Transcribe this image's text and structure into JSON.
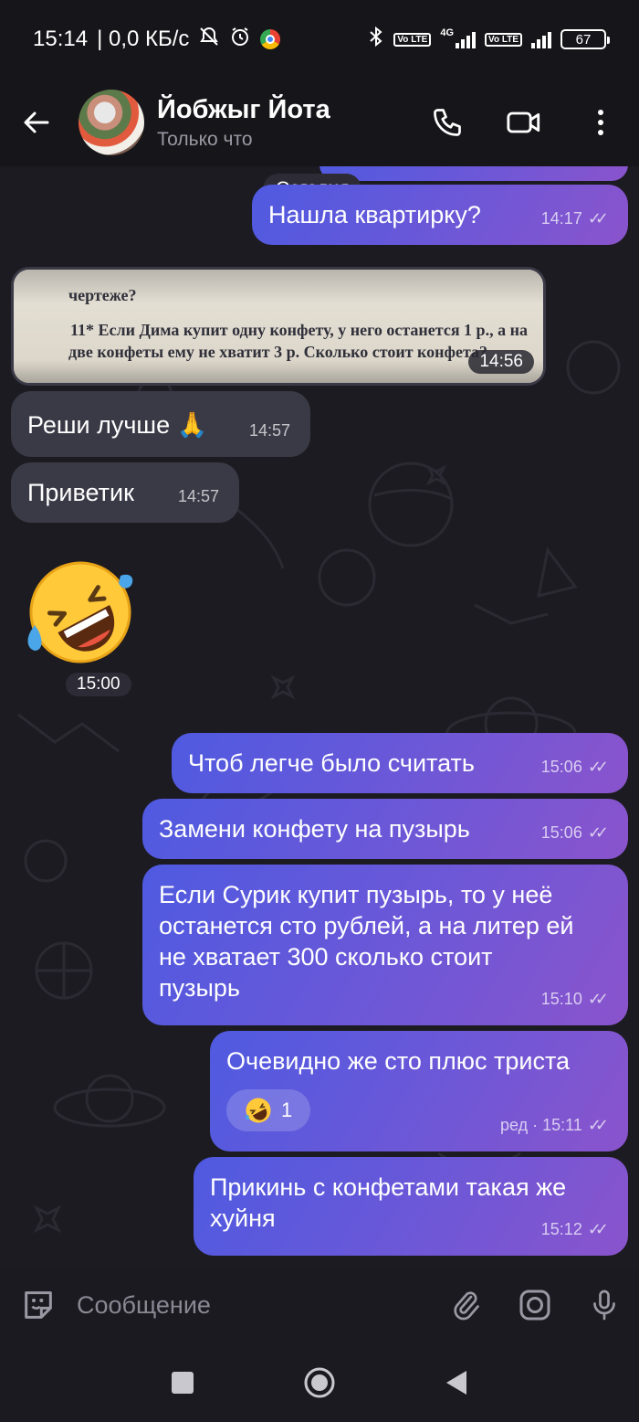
{
  "status_bar": {
    "time": "15:14",
    "speed": "| 0,0 КБ/с",
    "network": "4G",
    "lte_label": "Vo LTE",
    "battery": "67"
  },
  "header": {
    "name": "Йобжыг Йота",
    "status": "Только что"
  },
  "chat": {
    "date_divider": "Сегодня",
    "messages": [
      {
        "direction": "out",
        "text": "Нашла квартирку?",
        "time": "14:17"
      },
      {
        "direction": "in",
        "type": "photo",
        "photo_lines": [
          "чертеже?",
          "11* Если Дима купит одну конфету, у него останется 1 р., а на",
          "две конфеты ему не хватит 3 р. Сколько стоит конфета?"
        ],
        "time": "14:56"
      },
      {
        "direction": "in",
        "text": "Реши лучше 🙏",
        "time": "14:57"
      },
      {
        "direction": "in",
        "text": "Приветик",
        "time": "14:57"
      },
      {
        "direction": "in",
        "type": "emoji",
        "emoji": "rolling-on-floor-laughing",
        "time": "15:00"
      },
      {
        "direction": "out",
        "text": "Чтоб легче было считать",
        "time": "15:06"
      },
      {
        "direction": "out",
        "text": "Замени конфету на пузырь",
        "time": "15:06"
      },
      {
        "direction": "out",
        "text_lines": [
          "Если Сурик купит пузырь, то у неё",
          "останется сто рублей, а на литер ей",
          "не хватает 300 сколько стоит",
          "пузырь"
        ],
        "time": "15:10"
      },
      {
        "direction": "out",
        "text": "Очевидно же сто плюс триста",
        "reaction_count": "1",
        "edited": "ред · 15:11"
      },
      {
        "direction": "out",
        "text_lines": [
          "Прикинь с конфетами такая же",
          "хуйня"
        ],
        "time": "15:12"
      }
    ]
  },
  "composer": {
    "placeholder": "Сообщение"
  },
  "colors": {
    "outgoing_start": "#4f5ae0",
    "outgoing_end": "#8a54cc",
    "incoming": "#3a3946",
    "background": "#1c1b21"
  }
}
